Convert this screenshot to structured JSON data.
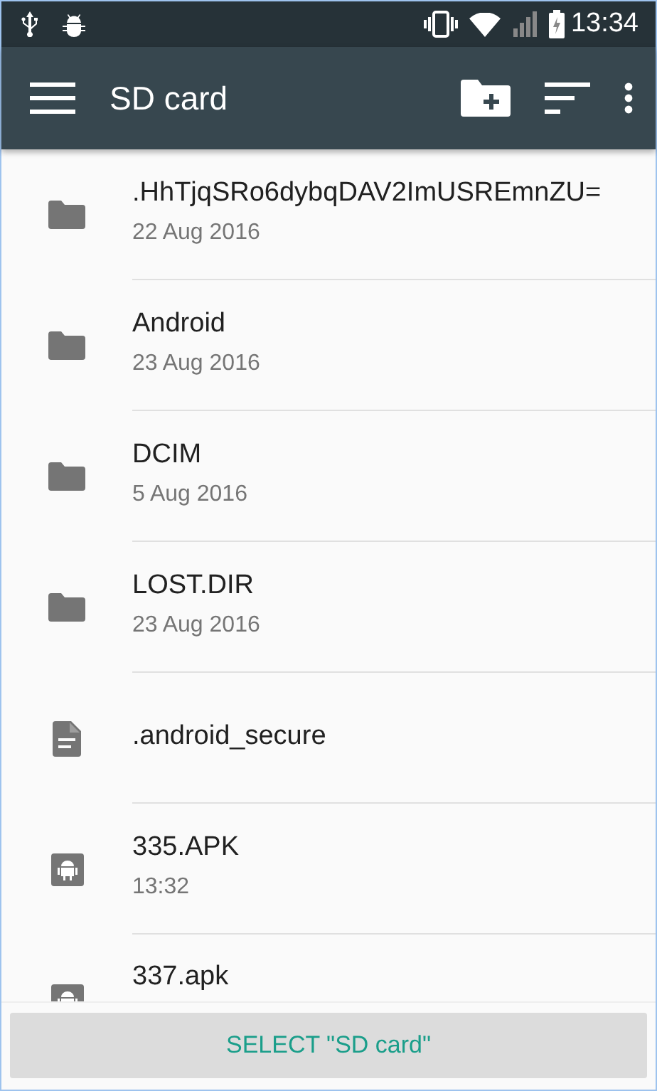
{
  "status_bar": {
    "time": "13:34"
  },
  "toolbar": {
    "title": "SD card"
  },
  "files": [
    {
      "kind": "folder",
      "name": ".HhTjqSRo6dybqDAV2ImUSREmnZU=",
      "date": "22 Aug 2016"
    },
    {
      "kind": "folder",
      "name": "Android",
      "date": "23 Aug 2016"
    },
    {
      "kind": "folder",
      "name": "DCIM",
      "date": "5 Aug 2016"
    },
    {
      "kind": "folder",
      "name": "LOST.DIR",
      "date": "23 Aug 2016"
    },
    {
      "kind": "document",
      "name": ".android_secure"
    },
    {
      "kind": "apk",
      "name": "335.APK",
      "date": "13:32"
    },
    {
      "kind": "apk",
      "name": "337.apk"
    }
  ],
  "select_button": "SELECT \"SD card\""
}
